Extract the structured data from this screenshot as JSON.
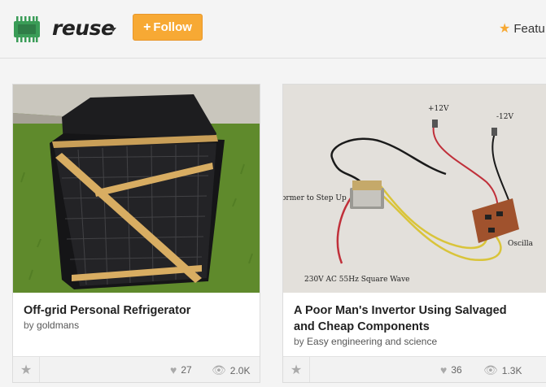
{
  "header": {
    "brand": "reuse",
    "follow_label": "Follow",
    "follow_plus": "+",
    "featured_label": "Featu",
    "icons": {
      "logo": "circuit-chip-icon",
      "caret": "chevron-down-icon",
      "featured": "star-icon"
    },
    "colors": {
      "accent": "#f7a934",
      "logo_green": "#3a9c57"
    }
  },
  "cards": [
    {
      "title": "Off-grid Personal Refrigerator",
      "by": "by",
      "author": "goldmans",
      "favorites": "27",
      "views": "2.0K"
    },
    {
      "title": "A Poor Man's Invertor Using Salvaged and Cheap Components",
      "by": "by",
      "author": "Easy engineering and science",
      "favorites": "36",
      "views": "1.3K",
      "photo_labels": {
        "plus12": "+12V",
        "minus12": "-12V",
        "transformer": "ormer to Step Up",
        "oscillator": "Oscilla",
        "wave": "230V AC 55Hz Square Wave"
      }
    }
  ]
}
